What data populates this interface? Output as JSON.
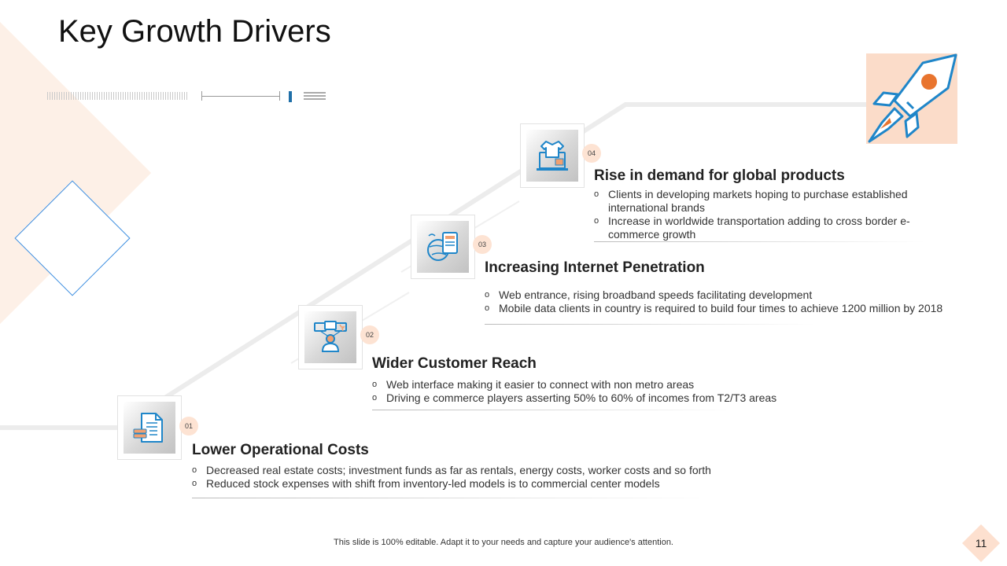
{
  "slide": {
    "title": "Key Growth Drivers",
    "footer": "This slide is 100% editable. Adapt it to your needs and capture your audience's attention.",
    "page_number": "11"
  },
  "drivers": [
    {
      "number": "01",
      "heading": "Lower Operational Costs",
      "icon": "document-money-icon",
      "bullets": [
        "Decreased real estate costs; investment funds as far as rentals, energy costs, worker costs and so forth",
        "Reduced stock expenses with shift from  inventory-led models is to commercial center models"
      ]
    },
    {
      "number": "02",
      "heading": "Wider Customer Reach",
      "icon": "customer-network-icon",
      "bullets": [
        "Web interface making it easier to connect with non metro areas",
        "Driving e commerce players asserting 50% to 60% of incomes from T2/T3 areas"
      ]
    },
    {
      "number": "03",
      "heading": "Increasing Internet Penetration",
      "icon": "globe-device-icon",
      "bullets": [
        "Web entrance, rising broadband speeds facilitating development",
        "Mobile data clients in country is required to build four times to achieve 1200 million by 2018"
      ]
    },
    {
      "number": "04",
      "heading": "Rise in demand for global products",
      "icon": "online-shopping-icon",
      "bullets": [
        "Clients in developing markets hoping to purchase established international brands",
        "Increase in worldwide  transportation adding to cross border e-commerce growth"
      ]
    }
  ],
  "colors": {
    "accent_orange": "#e8742e",
    "accent_blue": "#1f86c9",
    "peach": "#fbdcc9"
  }
}
